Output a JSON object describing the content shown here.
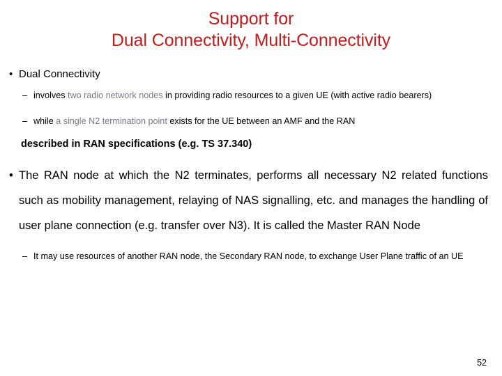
{
  "slide": {
    "page_number": "52",
    "title_color": "#C41A1A",
    "faded_text_color": "#7b7b87",
    "background_color": "#ffffff",
    "title": {
      "line1": "Support for",
      "line2": "Dual Connectivity, Multi-Connectivity"
    },
    "bullets": {
      "bullet_glyph": "•",
      "dash_glyph": "–"
    },
    "content": {
      "item1_label": "Dual Connectivity",
      "sub1_faded": "two radio network nodes",
      "sub1_prefix": "involves ",
      "sub1_suffix": " in providing radio resources to a given UE (with active radio bearers)",
      "sub2_prefix": "while ",
      "sub2_faded": "a single N2 termination point",
      "sub2_suffix": " exists for the UE between an AMF and the RAN",
      "bold_note": "described in RAN specifications (e.g. TS 37.340)",
      "para_main": "The RAN node at which the N2 terminates, performs all necessary N2 related functions such as mobility management, relaying of NAS signalling, etc. and manages the handling of user plane connection (e.g. transfer over N3). It is called the Master RAN Node",
      "sub3": "It may use resources of another RAN node, the Secondary RAN node, to exchange User Plane traffic of an UE"
    }
  }
}
